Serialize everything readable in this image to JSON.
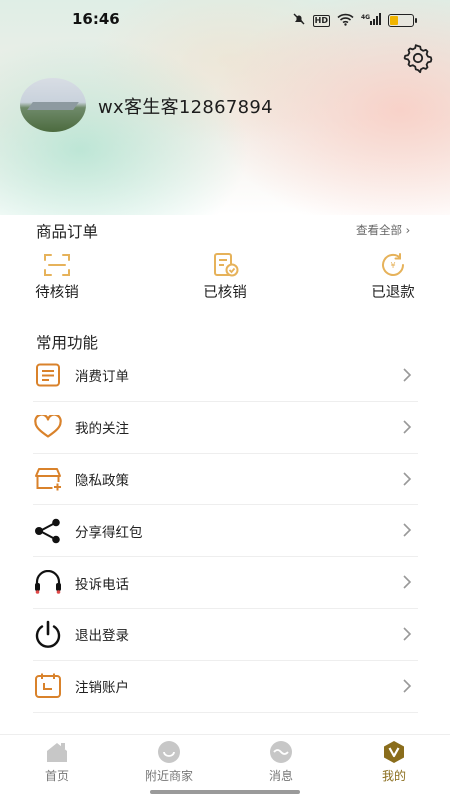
{
  "status_bar": {
    "time": "16:46",
    "hd_label": "HD",
    "signal_label": "4G",
    "battery_fraction": 0.35
  },
  "profile": {
    "username": "wx客生客12867894",
    "settings_icon": "gear-icon"
  },
  "orders": {
    "title": "商品订单",
    "view_all": "查看全部 ›",
    "items": [
      {
        "label": "待核销",
        "icon": "scan-frame-icon"
      },
      {
        "label": "已核销",
        "icon": "verified-document-icon"
      },
      {
        "label": "已退款",
        "icon": "refund-coin-icon"
      }
    ]
  },
  "functions": {
    "title": "常用功能",
    "items": [
      {
        "label": "消费订单",
        "icon": "order-list-icon"
      },
      {
        "label": "我的关注",
        "icon": "heart-icon"
      },
      {
        "label": "隐私政策",
        "icon": "shop-box-icon"
      },
      {
        "label": "分享得红包",
        "icon": "share-icon"
      },
      {
        "label": "投诉电话",
        "icon": "headset-icon"
      },
      {
        "label": "退出登录",
        "icon": "power-icon"
      },
      {
        "label": "注销账户",
        "icon": "calendar-icon"
      }
    ]
  },
  "tabbar": {
    "items": [
      {
        "label": "首页",
        "icon": "home-icon",
        "active": false
      },
      {
        "label": "附近商家",
        "icon": "nearby-icon",
        "active": false
      },
      {
        "label": "消息",
        "icon": "message-icon",
        "active": false
      },
      {
        "label": "我的",
        "icon": "profile-v-icon",
        "active": true
      }
    ],
    "active_color": "#8a6d1c"
  },
  "colors": {
    "accent_orange": "#d9822b",
    "order_icon_gold": "#e6b25a"
  }
}
